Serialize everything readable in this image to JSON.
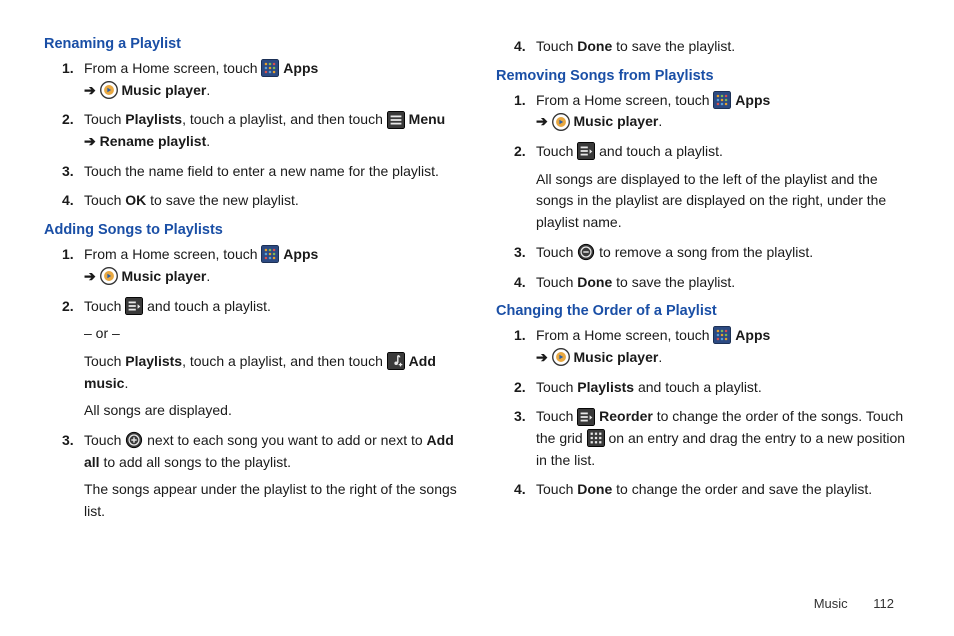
{
  "col1": {
    "sec1": {
      "heading": "Renaming a Playlist",
      "s1a": "From a Home screen, touch ",
      "apps": "Apps",
      "arrow": "➔",
      "music_player": "Music player",
      "s2a": "Touch ",
      "playlists": "Playlists",
      "s2b": ", touch a playlist, and then touch ",
      "menu": "Menu",
      "rename": "Rename playlist",
      "s3": "Touch the name field to enter a new name for the playlist.",
      "s4a": "Touch ",
      "ok": "OK",
      "s4b": " to save the new playlist."
    },
    "sec2": {
      "heading": "Adding Songs to Playlists",
      "s1a": "From a Home screen, touch ",
      "apps": "Apps",
      "arrow": "➔",
      "music_player": "Music player",
      "s2a": "Touch ",
      "s2b": " and touch a playlist.",
      "or": "– or –",
      "s2c": "Touch ",
      "playlists": "Playlists",
      "s2d": ", touch a playlist, and then touch ",
      "add_music": "Add music",
      "s2e": "All songs are displayed.",
      "s3a": "Touch ",
      "s3b": " next to each song you want to add or next to ",
      "add_all": "Add all",
      "s3c": " to add all songs to the playlist.",
      "s3d": "The songs appear under the playlist to the right of the songs list."
    }
  },
  "col2": {
    "sec0": {
      "s4a": "Touch ",
      "done": "Done",
      "s4b": " to save the playlist."
    },
    "sec1": {
      "heading": "Removing Songs from Playlists",
      "s1a": "From a Home screen, touch ",
      "apps": "Apps",
      "arrow": "➔",
      "music_player": "Music player",
      "s2a": "Touch ",
      "s2b": " and touch a playlist.",
      "s2c": "All songs are displayed to the left of the playlist and the songs in the playlist are displayed on the right, under the playlist name.",
      "s3a": "Touch ",
      "s3b": " to remove a song from the playlist.",
      "s4a": "Touch ",
      "done": "Done",
      "s4b": " to save the playlist."
    },
    "sec2": {
      "heading": "Changing the Order of a Playlist",
      "s1a": "From a Home screen, touch ",
      "apps": "Apps",
      "arrow": "➔",
      "music_player": "Music player",
      "s2a": "Touch ",
      "playlists": "Playlists",
      "s2b": " and touch a playlist.",
      "s3a": "Touch ",
      "reorder": "Reorder",
      "s3b": " to change the order of the songs. Touch the grid ",
      "s3c": " on an entry and drag the entry to a new position in the list.",
      "s4a": "Touch ",
      "done": "Done",
      "s4b": " to change the order and save the playlist."
    }
  },
  "footer": {
    "section": "Music",
    "page": "112"
  }
}
